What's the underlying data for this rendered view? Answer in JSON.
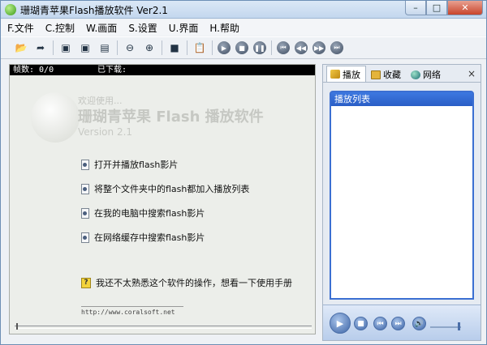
{
  "window": {
    "title": "珊瑚青苹果Flash播放软件 Ver2.1",
    "controls": {
      "minimize": "–",
      "maximize": "□",
      "close": "✕"
    }
  },
  "menu": [
    "F.文件",
    "C.控制",
    "W.画面",
    "S.设置",
    "U.界面",
    "H.帮助"
  ],
  "toolbar": {
    "icons": [
      "open-folder-icon",
      "open-url-icon",
      "save-icon",
      "save-as-icon",
      "export-icon",
      "zoom-out-icon",
      "zoom-in-icon",
      "fullscreen-icon",
      "clipboard-icon",
      "play-icon",
      "stop-icon",
      "pause-icon",
      "first-frame-icon",
      "prev-frame-icon",
      "next-frame-icon",
      "last-frame-icon"
    ]
  },
  "player": {
    "frames_label": "帧数: 0/0",
    "downloaded_label": "已下载:",
    "logo": {
      "welcome": "欢迎使用...",
      "title": "珊瑚青苹果 Flash 播放软件",
      "version": "Version 2.1"
    },
    "actions": [
      "打开并播放flash影片",
      "将整个文件夹中的flash都加入播放列表",
      "在我的电脑中搜索flash影片",
      "在网络缓存中搜索flash影片"
    ],
    "help_text": "我还不太熟悉这个软件的操作，想看一下使用手册",
    "url": "http://www.coralsoft.net",
    "progress": 0
  },
  "side": {
    "tabs": [
      "播放",
      "收藏",
      "网络"
    ],
    "close": "×",
    "playlist_title": "播放列表",
    "volume": 0.9
  }
}
